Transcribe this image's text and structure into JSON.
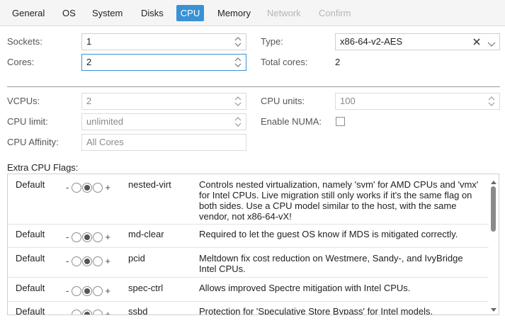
{
  "tabs": [
    {
      "label": "General",
      "state": "normal"
    },
    {
      "label": "OS",
      "state": "normal"
    },
    {
      "label": "System",
      "state": "normal"
    },
    {
      "label": "Disks",
      "state": "normal"
    },
    {
      "label": "CPU",
      "state": "active"
    },
    {
      "label": "Memory",
      "state": "normal"
    },
    {
      "label": "Network",
      "state": "disabled"
    },
    {
      "label": "Confirm",
      "state": "disabled"
    }
  ],
  "form": {
    "sockets_label": "Sockets:",
    "sockets_value": "1",
    "cores_label": "Cores:",
    "cores_value": "2",
    "type_label": "Type:",
    "type_value": "x86-64-v2-AES",
    "total_cores_label": "Total cores:",
    "total_cores_value": "2",
    "vcpus_label": "VCPUs:",
    "vcpus_value": "2",
    "cpu_units_label": "CPU units:",
    "cpu_units_value": "100",
    "cpu_limit_label": "CPU limit:",
    "cpu_limit_value": "unlimited",
    "enable_numa_label": "Enable NUMA:",
    "enable_numa_checked": false,
    "cpu_affinity_label": "CPU Affinity:",
    "cpu_affinity_placeholder": "All Cores"
  },
  "flags": {
    "title": "Extra CPU Flags:",
    "minus": "-",
    "plus": "+",
    "rows": [
      {
        "state": "Default",
        "name": "nested-virt",
        "selected": "middle",
        "desc": "Controls nested virtualization, namely 'svm' for AMD CPUs and 'vmx' for Intel CPUs. Live migration still only works if it's the same flag on both sides. Use a CPU model similar to the host, with the same vendor, not x86-64-vX!"
      },
      {
        "state": "Default",
        "name": "md-clear",
        "selected": "middle",
        "desc": "Required to let the guest OS know if MDS is mitigated correctly."
      },
      {
        "state": "Default",
        "name": "pcid",
        "selected": "middle",
        "desc": "Meltdown fix cost reduction on Westmere, Sandy-, and IvyBridge Intel CPUs."
      },
      {
        "state": "Default",
        "name": "spec-ctrl",
        "selected": "middle",
        "desc": "Allows improved Spectre mitigation with Intel CPUs."
      },
      {
        "state": "Default",
        "name": "ssbd",
        "selected": "middle",
        "desc": "Protection for 'Speculative Store Bypass' for Intel models."
      }
    ]
  },
  "colors": {
    "accent": "#3892d4",
    "disabled_text": "#b5b5b5"
  }
}
